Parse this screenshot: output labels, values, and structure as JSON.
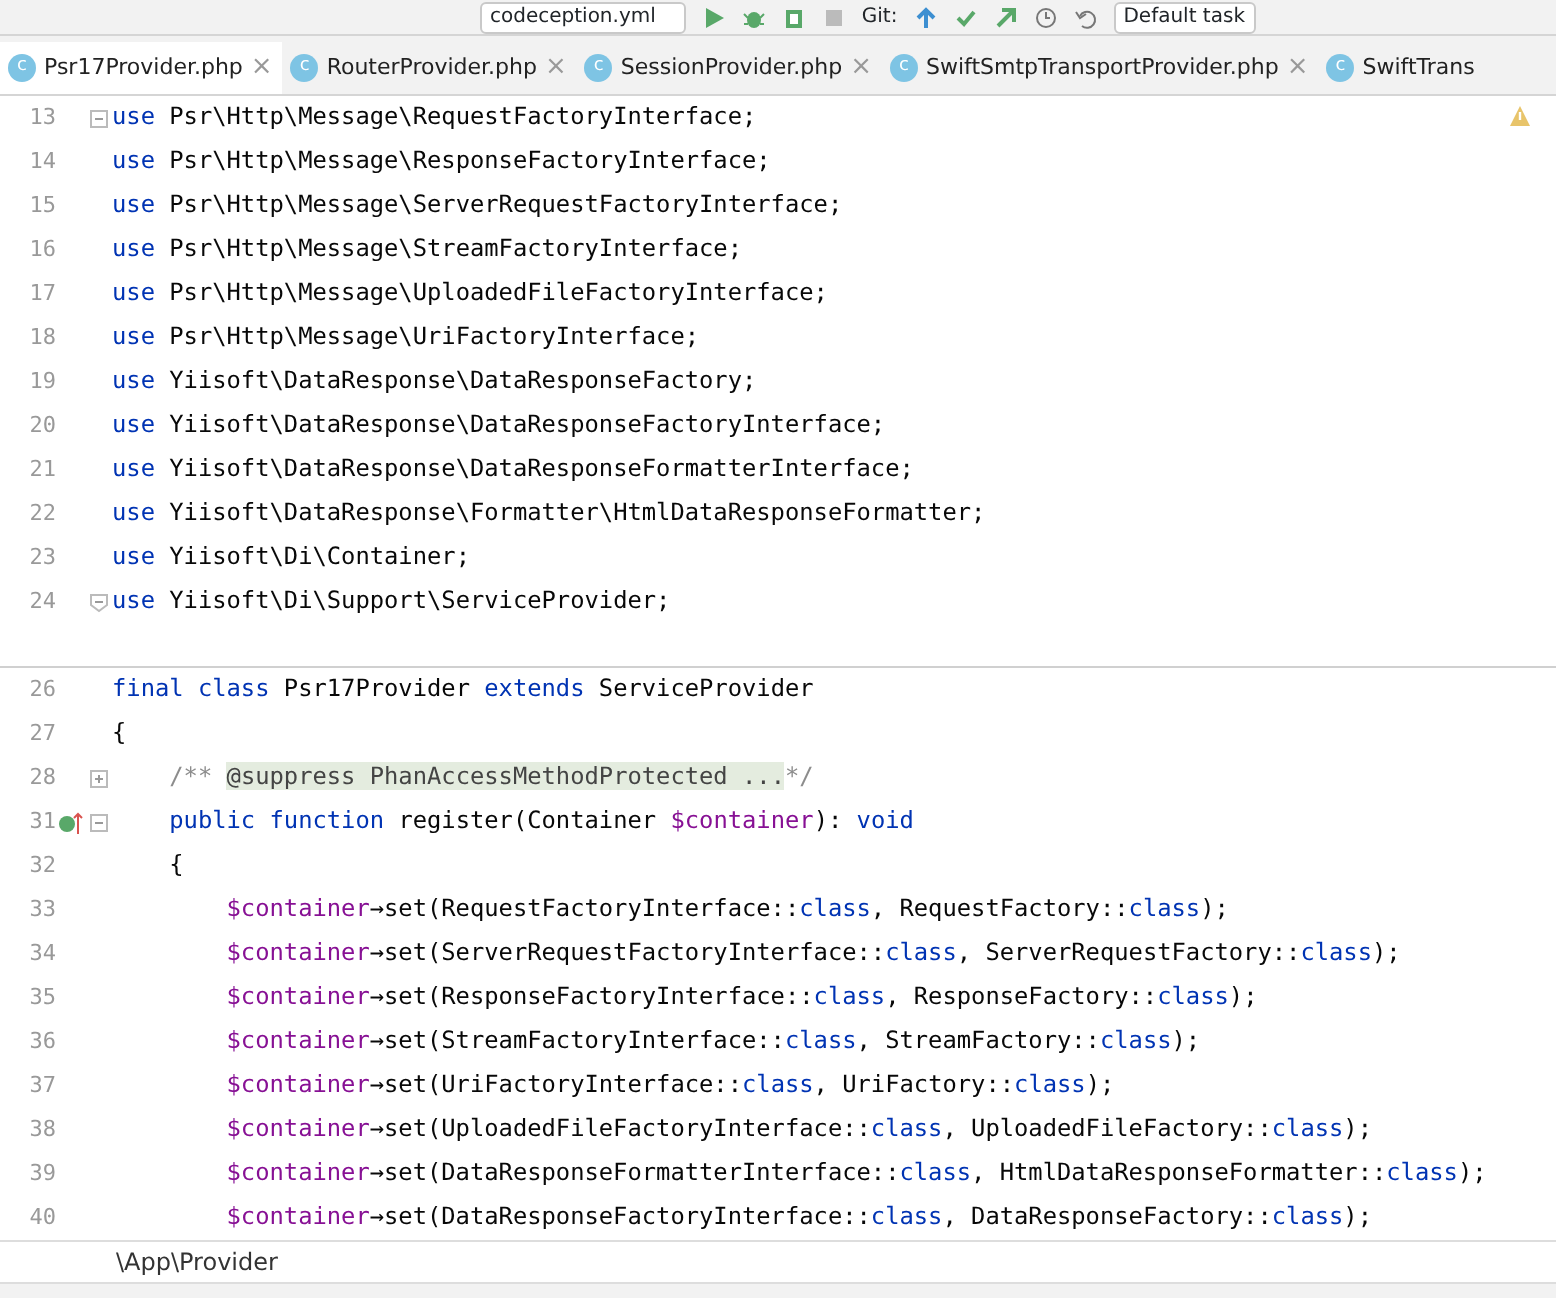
{
  "toolbar": {
    "run_config": "codeception.yml",
    "vcs_label": "Git:",
    "task": "Default task"
  },
  "tabs": [
    {
      "icon": "c",
      "label": "Psr17Provider.php",
      "close": "×",
      "selected": true
    },
    {
      "icon": "c",
      "label": "RouterProvider.php",
      "close": "×",
      "selected": false
    },
    {
      "icon": "c",
      "label": "SessionProvider.php",
      "close": "×",
      "selected": false
    },
    {
      "icon": "c",
      "label": "SwiftSmtpTransportProvider.php",
      "close": "×",
      "selected": false
    },
    {
      "icon": "c",
      "label": "SwiftTrans",
      "selected": false
    }
  ],
  "editor": {
    "warning": true,
    "lines": [
      {
        "number": "13",
        "fold_start": true,
        "tokens": [
          {
            "kind": "keyword",
            "text": "use"
          },
          {
            "kind": "plain",
            "text": " Psr\\Http\\Message\\RequestFactoryInterface;"
          }
        ]
      },
      {
        "number": "14",
        "tokens": [
          {
            "kind": "keyword",
            "text": "use"
          },
          {
            "kind": "plain",
            "text": " Psr\\Http\\Message\\ResponseFactoryInterface;"
          }
        ]
      },
      {
        "number": "15",
        "tokens": [
          {
            "kind": "keyword",
            "text": "use"
          },
          {
            "kind": "plain",
            "text": " Psr\\Http\\Message\\ServerRequestFactoryInterface;"
          }
        ]
      },
      {
        "number": "16",
        "tokens": [
          {
            "kind": "keyword",
            "text": "use"
          },
          {
            "kind": "plain",
            "text": " Psr\\Http\\Message\\StreamFactoryInterface;"
          }
        ]
      },
      {
        "number": "17",
        "tokens": [
          {
            "kind": "keyword",
            "text": "use"
          },
          {
            "kind": "plain",
            "text": " Psr\\Http\\Message\\UploadedFileFactoryInterface;"
          }
        ]
      },
      {
        "number": "18",
        "tokens": [
          {
            "kind": "keyword",
            "text": "use"
          },
          {
            "kind": "plain",
            "text": " Psr\\Http\\Message\\UriFactoryInterface;"
          }
        ]
      },
      {
        "number": "19",
        "tokens": [
          {
            "kind": "keyword",
            "text": "use"
          },
          {
            "kind": "plain",
            "text": " Yiisoft\\DataResponse\\DataResponseFactory;"
          }
        ]
      },
      {
        "number": "20",
        "tokens": [
          {
            "kind": "keyword",
            "text": "use"
          },
          {
            "kind": "plain",
            "text": " Yiisoft\\DataResponse\\DataResponseFactoryInterface;"
          }
        ]
      },
      {
        "number": "21",
        "tokens": [
          {
            "kind": "keyword",
            "text": "use"
          },
          {
            "kind": "plain",
            "text": " Yiisoft\\DataResponse\\DataResponseFormatterInterface;"
          }
        ]
      },
      {
        "number": "22",
        "tokens": [
          {
            "kind": "keyword",
            "text": "use"
          },
          {
            "kind": "plain",
            "text": " Yiisoft\\DataResponse\\Formatter\\HtmlDataResponseFormatter;"
          }
        ]
      },
      {
        "number": "23",
        "tokens": [
          {
            "kind": "keyword",
            "text": "use"
          },
          {
            "kind": "plain",
            "text": " Yiisoft\\Di\\Container;"
          }
        ]
      },
      {
        "number": "24",
        "fold_end": true,
        "tokens": [
          {
            "kind": "keyword",
            "text": "use"
          },
          {
            "kind": "plain",
            "text": " Yiisoft\\Di\\Support\\ServiceProvider;"
          }
        ]
      },
      {
        "separator": true
      },
      {
        "number": "26",
        "tokens": [
          {
            "kind": "keyword",
            "text": "final class"
          },
          {
            "kind": "plain",
            "text": " Psr17Provider "
          },
          {
            "kind": "keyword",
            "text": "extends"
          },
          {
            "kind": "plain",
            "text": " ServiceProvider"
          }
        ]
      },
      {
        "number": "27",
        "tokens": [
          {
            "kind": "plain",
            "text": "{"
          }
        ]
      },
      {
        "number": "28",
        "fold_start": true,
        "collapsed": true,
        "tokens": [
          {
            "kind": "comment",
            "text": "    /** "
          },
          {
            "kind": "folded",
            "text": "@suppress PhanAccessMethodProtected ..."
          },
          {
            "kind": "comment",
            "text": "*/"
          }
        ]
      },
      {
        "number": "31",
        "fold_start": true,
        "collapsed": false,
        "implements": true,
        "tokens": [
          {
            "kind": "keyword",
            "text": "    public function"
          },
          {
            "kind": "plain",
            "text": " register(Container "
          },
          {
            "kind": "variable",
            "text": "$container"
          },
          {
            "kind": "plain",
            "text": "): "
          },
          {
            "kind": "keyword",
            "text": "void"
          }
        ]
      },
      {
        "number": "32",
        "tokens": [
          {
            "kind": "plain",
            "text": "    {"
          }
        ]
      },
      {
        "number": "33",
        "tokens": [
          {
            "kind": "variable",
            "text": "        $container"
          },
          {
            "kind": "plain",
            "text": "→set(RequestFactoryInterface::"
          },
          {
            "kind": "keyword",
            "text": "class"
          },
          {
            "kind": "plain",
            "text": ", RequestFactory::"
          },
          {
            "kind": "keyword",
            "text": "class"
          },
          {
            "kind": "plain",
            "text": ");"
          }
        ]
      },
      {
        "number": "34",
        "tokens": [
          {
            "kind": "variable",
            "text": "        $container"
          },
          {
            "kind": "plain",
            "text": "→set(ServerRequestFactoryInterface::"
          },
          {
            "kind": "keyword",
            "text": "class"
          },
          {
            "kind": "plain",
            "text": ", ServerRequestFactory::"
          },
          {
            "kind": "keyword",
            "text": "class"
          },
          {
            "kind": "plain",
            "text": ");"
          }
        ]
      },
      {
        "number": "35",
        "tokens": [
          {
            "kind": "variable",
            "text": "        $container"
          },
          {
            "kind": "plain",
            "text": "→set(ResponseFactoryInterface::"
          },
          {
            "kind": "keyword",
            "text": "class"
          },
          {
            "kind": "plain",
            "text": ", ResponseFactory::"
          },
          {
            "kind": "keyword",
            "text": "class"
          },
          {
            "kind": "plain",
            "text": ");"
          }
        ]
      },
      {
        "number": "36",
        "tokens": [
          {
            "kind": "variable",
            "text": "        $container"
          },
          {
            "kind": "plain",
            "text": "→set(StreamFactoryInterface::"
          },
          {
            "kind": "keyword",
            "text": "class"
          },
          {
            "kind": "plain",
            "text": ", StreamFactory::"
          },
          {
            "kind": "keyword",
            "text": "class"
          },
          {
            "kind": "plain",
            "text": ");"
          }
        ]
      },
      {
        "number": "37",
        "tokens": [
          {
            "kind": "variable",
            "text": "        $container"
          },
          {
            "kind": "plain",
            "text": "→set(UriFactoryInterface::"
          },
          {
            "kind": "keyword",
            "text": "class"
          },
          {
            "kind": "plain",
            "text": ", UriFactory::"
          },
          {
            "kind": "keyword",
            "text": "class"
          },
          {
            "kind": "plain",
            "text": ");"
          }
        ]
      },
      {
        "number": "38",
        "tokens": [
          {
            "kind": "variable",
            "text": "        $container"
          },
          {
            "kind": "plain",
            "text": "→set(UploadedFileFactoryInterface::"
          },
          {
            "kind": "keyword",
            "text": "class"
          },
          {
            "kind": "plain",
            "text": ", UploadedFileFactory::"
          },
          {
            "kind": "keyword",
            "text": "class"
          },
          {
            "kind": "plain",
            "text": ");"
          }
        ]
      },
      {
        "number": "39",
        "tokens": [
          {
            "kind": "variable",
            "text": "        $container"
          },
          {
            "kind": "plain",
            "text": "→set(DataResponseFormatterInterface::"
          },
          {
            "kind": "keyword",
            "text": "class"
          },
          {
            "kind": "plain",
            "text": ", HtmlDataResponseFormatter::"
          },
          {
            "kind": "keyword",
            "text": "class"
          },
          {
            "kind": "plain",
            "text": ");"
          }
        ]
      },
      {
        "number": "40",
        "tokens": [
          {
            "kind": "variable",
            "text": "        $container"
          },
          {
            "kind": "plain",
            "text": "→set(DataResponseFactoryInterface::"
          },
          {
            "kind": "keyword",
            "text": "class"
          },
          {
            "kind": "plain",
            "text": ", DataResponseFactory::"
          },
          {
            "kind": "keyword",
            "text": "class"
          },
          {
            "kind": "plain",
            "text": ");"
          }
        ]
      }
    ]
  },
  "breadcrumb": "\\App\\Provider"
}
